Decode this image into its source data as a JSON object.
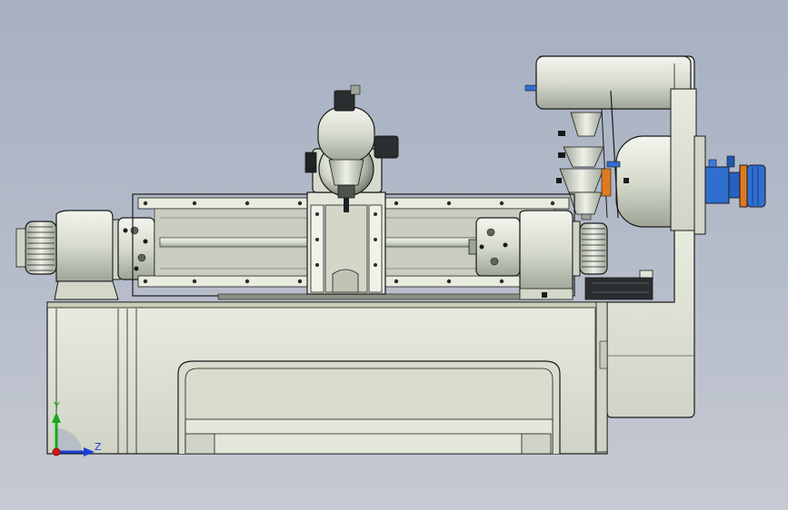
{
  "viewport": {
    "background_top": "#a6b0c2",
    "background_bottom": "#c6cad2"
  },
  "colors": {
    "machine_body": "#dfe4d6",
    "machine_shade": "#b9bfb0",
    "outline": "#1a1a1a",
    "guard_blue": "#2f6fd0",
    "guard_orange": "#e07a1f",
    "axis_x": "#d01818",
    "axis_y": "#1aa81a",
    "axis_z": "#1d3fd8"
  },
  "triad": {
    "y_label": "Y",
    "z_label": "Z"
  }
}
